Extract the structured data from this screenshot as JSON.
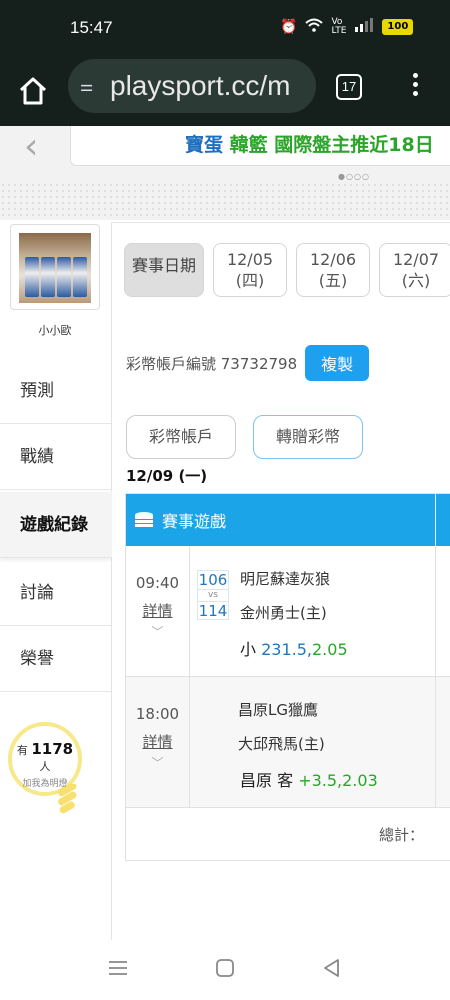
{
  "status": {
    "time": "15:47",
    "battery": "100"
  },
  "browser": {
    "url": "playsport.cc/m",
    "tab_count": "17"
  },
  "banner": {
    "headline_part1": "寶蛋",
    "headline_part2": "韓籃 國際盤主推近18日"
  },
  "sidebar": {
    "username": "小小歐",
    "items": [
      {
        "label": "預測"
      },
      {
        "label": "戰績"
      },
      {
        "label": "遊戲紀錄"
      },
      {
        "label": "討論"
      },
      {
        "label": "榮譽"
      }
    ],
    "lamp_prefix": "有",
    "lamp_count": "1178",
    "lamp_suffix": "人",
    "lamp_sub": "加我為明燈"
  },
  "dates": {
    "label": "賽事日期",
    "chips": [
      {
        "date": "12/05",
        "weekday": "(四)"
      },
      {
        "date": "12/06",
        "weekday": "(五)"
      },
      {
        "date": "12/07",
        "weekday": "(六)"
      }
    ]
  },
  "account": {
    "label": "彩幣帳戶編號 73732798",
    "copy_label": "複製",
    "btn_account": "彩幣帳戶",
    "btn_gift": "轉贈彩幣"
  },
  "day_title": "12/09 (一)",
  "table": {
    "header": "賽事遊戲",
    "games": [
      {
        "time": "09:40",
        "detail": "詳情",
        "score_away": "106",
        "vs": "vs",
        "score_home": "114",
        "team_away": "明尼蘇達灰狼",
        "team_home": "金州勇士(主)",
        "bet_side": "小",
        "bet_line": "231.5,",
        "bet_odds": "2.05"
      },
      {
        "time": "18:00",
        "detail": "詳情",
        "team_away": "昌原LG獵鷹",
        "team_home": "大邱飛馬(主)",
        "bet_side": "昌原 客",
        "bet_line": "+3.5,",
        "bet_odds": "2.03"
      }
    ],
    "total_label": "總計："
  }
}
